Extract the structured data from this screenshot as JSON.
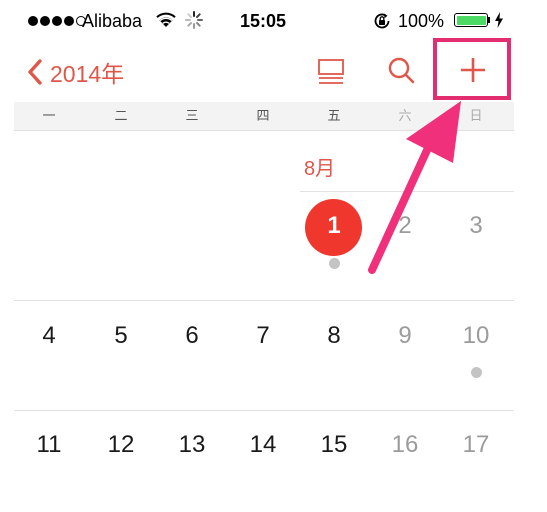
{
  "status_bar": {
    "carrier": "Alibaba",
    "time": "15:05",
    "battery_percent": "100%",
    "signal_bars_filled": 4,
    "signal_bars_total": 5
  },
  "nav": {
    "back_label": "2014年",
    "icons": [
      "list-icon",
      "search-icon",
      "plus-icon"
    ]
  },
  "weekdays": [
    "一",
    "二",
    "三",
    "四",
    "五",
    "六",
    "日"
  ],
  "calendar": {
    "month_label": "8月",
    "today": "1",
    "weeks": [
      [
        "",
        "",
        "",
        "",
        "1",
        "2",
        "3"
      ],
      [
        "4",
        "5",
        "6",
        "7",
        "8",
        "9",
        "10"
      ],
      [
        "11",
        "12",
        "13",
        "14",
        "15",
        "16",
        "17"
      ]
    ],
    "days_with_events": [
      "1",
      "10"
    ]
  },
  "colors": {
    "accent": "#e0574a",
    "today_circle": "#f0372e",
    "highlight_box": "#e32d71",
    "arrow": "#f0307a",
    "battery": "#4cd964"
  }
}
